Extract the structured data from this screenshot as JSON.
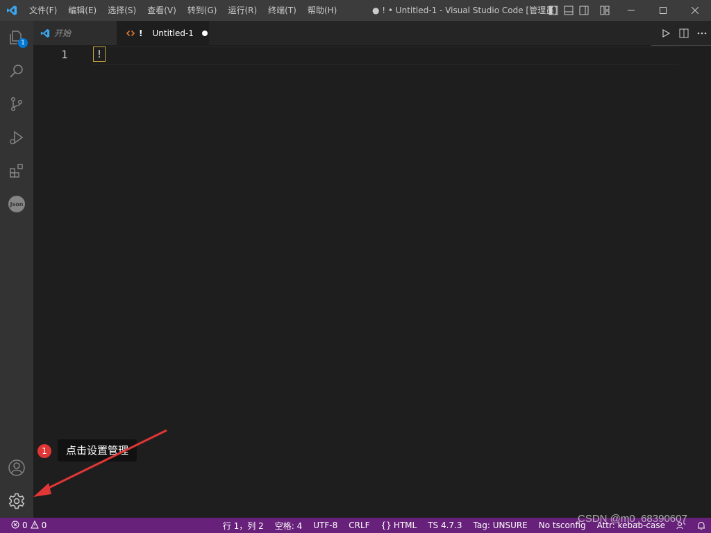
{
  "titlebar": {
    "menus": [
      "文件(F)",
      "编辑(E)",
      "选择(S)",
      "查看(V)",
      "转到(G)",
      "运行(R)",
      "终端(T)",
      "帮助(H)"
    ],
    "window_title": "● !  • Untitled-1 - Visual Studio Code [管理员]"
  },
  "activitybar": {
    "explorer_badge": "1",
    "json_label": "Json"
  },
  "tabs": [
    {
      "label": "开始",
      "active": false
    },
    {
      "label": "Untitled-1",
      "prefix": "!",
      "active": true,
      "dirty": true
    }
  ],
  "editor": {
    "line_number": "1",
    "line_text": "!"
  },
  "annotation": {
    "number": "1",
    "text": "点击设置管理"
  },
  "statusbar": {
    "errors": "0",
    "warnings": "0",
    "position": "行 1，列 2",
    "indent": "空格: 4",
    "encoding": "UTF-8",
    "eol": "CRLF",
    "language": "HTML",
    "ts_version": "TS 4.7.3",
    "tag": "Tag: UNSURE",
    "tsconfig": "No tsconfig",
    "attr": "Attr: kebab-case"
  },
  "watermark": "CSDN @m0_68390607",
  "colors": {
    "accent": "#0078d4",
    "statusbar": "#68217a",
    "annotation_red": "#e03636",
    "titlebar": "#3c3c3c",
    "activitybar": "#333333",
    "editor_bg": "#1e1e1e"
  }
}
